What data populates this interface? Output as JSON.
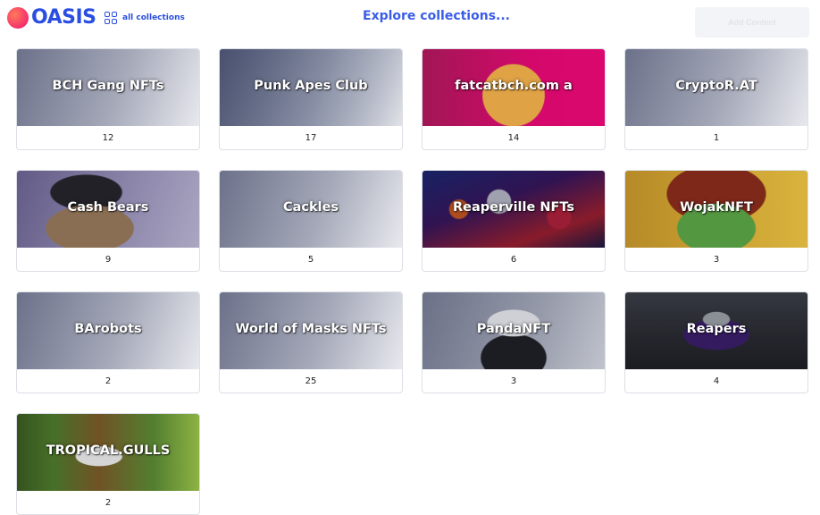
{
  "header": {
    "logo_text": "OASIS",
    "all_collections_label": "all collections",
    "explore_title": "Explore collections...",
    "add_button_label": "Add Content"
  },
  "colors": {
    "brand_blue": "#2a4fe0",
    "logo_gradient": [
      "#ff7a59",
      "#f5306e"
    ]
  },
  "collections": [
    {
      "name": "BCH Gang NFTs",
      "count": "12"
    },
    {
      "name": "Punk Apes Club",
      "count": "17"
    },
    {
      "name": "fatcatbch.com a",
      "count": "14"
    },
    {
      "name": "CryptoR.AT",
      "count": "1"
    },
    {
      "name": "Cash Bears",
      "count": "9"
    },
    {
      "name": "Cackles",
      "count": "5"
    },
    {
      "name": "Reaperville NFTs",
      "count": "6"
    },
    {
      "name": "WojakNFT",
      "count": "3"
    },
    {
      "name": "BArobots",
      "count": "2"
    },
    {
      "name": "World of Masks NFTs",
      "count": "25"
    },
    {
      "name": "PandaNFT",
      "count": "3"
    },
    {
      "name": "Reapers",
      "count": "4"
    },
    {
      "name": "TROPICAL.GULLS",
      "count": "2"
    }
  ]
}
